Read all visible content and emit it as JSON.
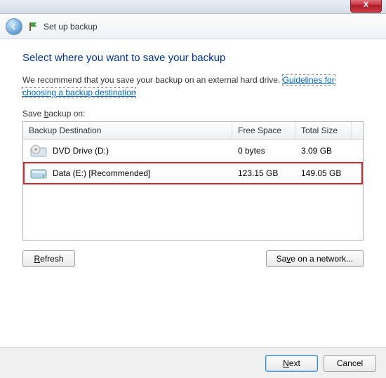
{
  "window": {
    "title": "Set up backup",
    "close_glyph": "X"
  },
  "page": {
    "heading": "Select where you want to save your backup",
    "recommend_prefix": "We recommend that you save your backup on an external hard drive. ",
    "recommend_link": "Guidelines for choosing a backup destination",
    "list_label": "Save backup on:"
  },
  "columns": {
    "dest": "Backup Destination",
    "free": "Free Space",
    "size": "Total Size"
  },
  "drives": [
    {
      "name": "DVD Drive (D:)",
      "free": "0 bytes",
      "size": "3.09 GB",
      "icon": "dvd",
      "selected": false
    },
    {
      "name": "Data (E:) [Recommended]",
      "free": "123.15 GB",
      "size": "149.05 GB",
      "icon": "hdd",
      "selected": true
    }
  ],
  "buttons": {
    "refresh": "Refresh",
    "network": "Save on a network...",
    "next": "Next",
    "cancel": "Cancel"
  }
}
